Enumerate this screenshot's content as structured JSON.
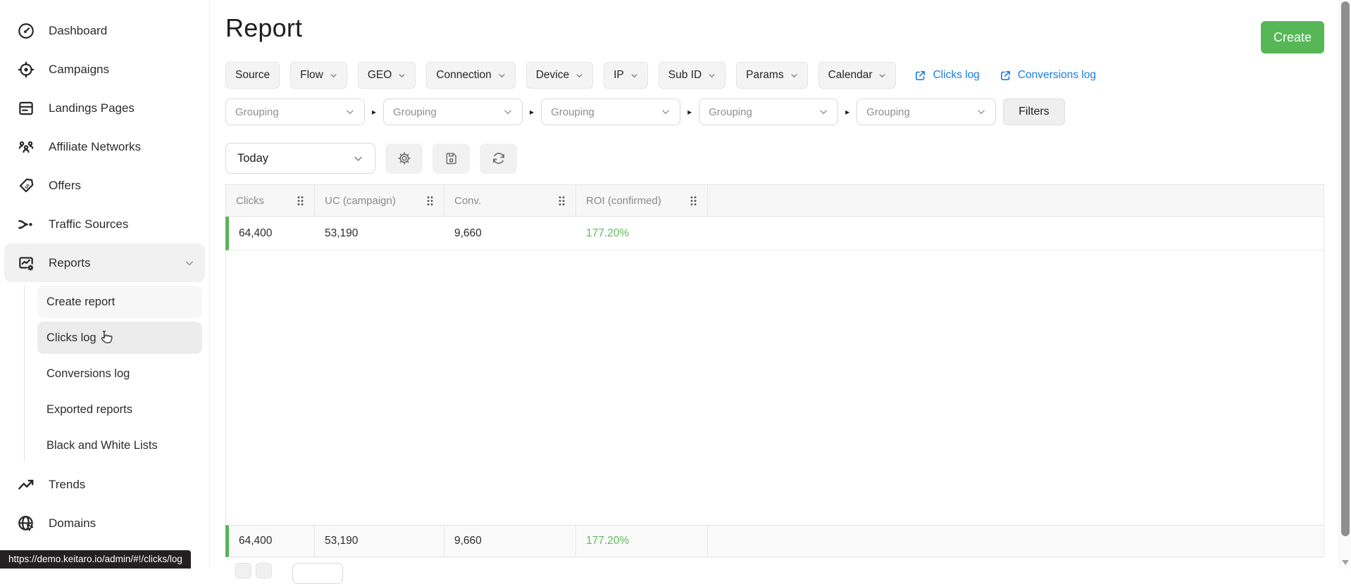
{
  "window": {
    "url_tooltip": "https://demo.keitaro.io/admin/#!/clicks/log"
  },
  "sidebar": {
    "items": [
      {
        "label": "Dashboard",
        "icon": "dashboard-icon"
      },
      {
        "label": "Campaigns",
        "icon": "campaigns-icon"
      },
      {
        "label": "Landings Pages",
        "icon": "landing-pages-icon"
      },
      {
        "label": "Affiliate Networks",
        "icon": "affiliate-networks-icon"
      },
      {
        "label": "Offers",
        "icon": "offers-icon"
      },
      {
        "label": "Traffic Sources",
        "icon": "traffic-sources-icon"
      },
      {
        "label": "Reports",
        "icon": "reports-icon",
        "expanded": true
      },
      {
        "label": "Trends",
        "icon": "trends-icon"
      },
      {
        "label": "Domains",
        "icon": "domains-icon"
      }
    ],
    "report_sub_items": [
      {
        "label": "Create report"
      },
      {
        "label": "Clicks log"
      },
      {
        "label": "Conversions log"
      },
      {
        "label": "Exported reports"
      },
      {
        "label": "Black and White Lists"
      }
    ]
  },
  "header": {
    "title": "Report",
    "create_button": "Create"
  },
  "filters": {
    "chips": [
      {
        "label": "Source",
        "chevron": false
      },
      {
        "label": "Flow",
        "chevron": true
      },
      {
        "label": "GEO",
        "chevron": true
      },
      {
        "label": "Connection",
        "chevron": true
      },
      {
        "label": "Device",
        "chevron": true
      },
      {
        "label": "IP",
        "chevron": true
      },
      {
        "label": "Sub ID",
        "chevron": true
      },
      {
        "label": "Params",
        "chevron": true
      },
      {
        "label": "Calendar",
        "chevron": true
      }
    ],
    "links": [
      {
        "label": "Clicks log"
      },
      {
        "label": "Conversions log"
      }
    ]
  },
  "grouping": {
    "placeholder": "Grouping",
    "separator": "▸",
    "filters_button": "Filters"
  },
  "toolbar": {
    "date_range": "Today",
    "icon_buttons": [
      "settings",
      "save",
      "refresh"
    ]
  },
  "table": {
    "columns": [
      "Clicks",
      "UC (campaign)",
      "Conv.",
      "ROI (confirmed)"
    ],
    "rows": [
      [
        "64,400",
        "53,190",
        "9,660",
        "177.20%"
      ]
    ],
    "footer": [
      "64,400",
      "53,190",
      "9,660",
      "177.20%"
    ]
  },
  "colors": {
    "accent_green": "#55b457",
    "roi_green": "#5dba5d",
    "link_blue": "#1d7ce0",
    "create_green": "#57b757"
  }
}
